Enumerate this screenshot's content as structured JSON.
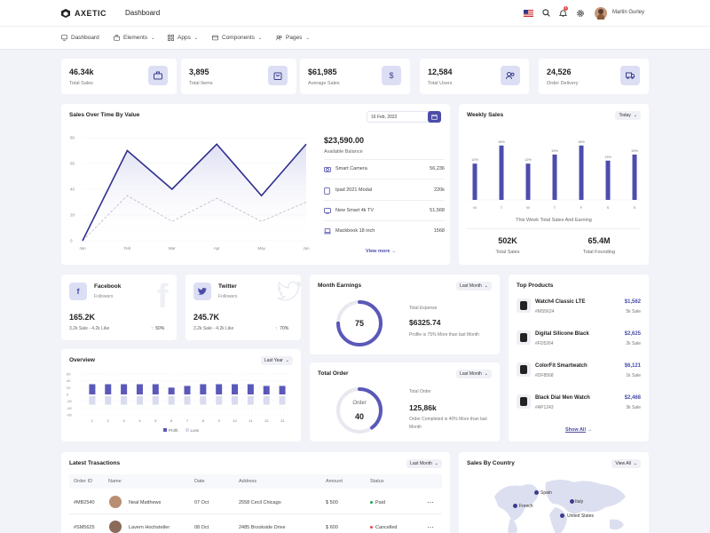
{
  "header": {
    "brand": "AXETIC",
    "page_title": "Dashboard",
    "user_name": "Martin Gurley",
    "notification_count": "4"
  },
  "nav": {
    "items": [
      {
        "label": "Dashboard",
        "icon": "monitor-icon"
      },
      {
        "label": "Elements",
        "icon": "briefcase-icon"
      },
      {
        "label": "Apps",
        "icon": "grid-icon"
      },
      {
        "label": "Components",
        "icon": "layers-icon"
      },
      {
        "label": "Pages",
        "icon": "users-icon"
      }
    ]
  },
  "stats": [
    {
      "value": "46.34k",
      "label": "Total Sales",
      "icon": "briefcase-icon"
    },
    {
      "value": "3,895",
      "label": "Total Items",
      "icon": "bag-icon"
    },
    {
      "value": "$61,985",
      "label": "Average Sales",
      "icon": "dollar-icon"
    },
    {
      "value": "12,584",
      "label": "Total Users",
      "icon": "users-icon"
    },
    {
      "value": "24,526",
      "label": "Order Delivery",
      "icon": "truck-icon"
    }
  ],
  "sales_over_time": {
    "title": "Sales Over Time By Value",
    "date": "16 Feb, 2022",
    "balance": "$23,590.00",
    "balance_label": "Available Balance",
    "items": [
      {
        "name": "Smart Camera",
        "value": "56,236",
        "icon": "camera-icon"
      },
      {
        "name": "Ipad 2021 Modal",
        "value": "220k",
        "icon": "tablet-icon"
      },
      {
        "name": "New Smart 4k TV",
        "value": "51,568",
        "icon": "tv-icon"
      },
      {
        "name": "Mackbook 18 inch",
        "value": "1568",
        "icon": "laptop-icon"
      }
    ],
    "view_more": "View more"
  },
  "weekly_sales": {
    "title": "Weekly Sales",
    "filter": "Today",
    "caption": "This Week Total Sales And Earning",
    "total_sales_value": "502K",
    "total_sales_label": "Total Sales",
    "total_founding_value": "65.4M",
    "total_founding_label": "Total Founding"
  },
  "facebook": {
    "title": "Facebook",
    "subtitle": "Followers",
    "value": "165.2K",
    "detail": "3.2k Sale - 4.2k Like",
    "percent": "50%"
  },
  "twitter": {
    "title": "Twitter",
    "subtitle": "Followers",
    "value": "245.7K",
    "detail": "3.2k Sale - 4.2k Like",
    "percent": "70%"
  },
  "month_earnings": {
    "title": "Month Earnings",
    "filter": "Last Month",
    "gauge_value": "75",
    "gauge_fraction": 0.75,
    "expense_label": "Total Expense",
    "expense_value": "$6325.74",
    "note": "Profile is 75% More than last Month"
  },
  "total_order": {
    "title": "Total Order",
    "filter": "Last Month",
    "gauge_label": "Order",
    "gauge_value": "40",
    "gauge_fraction": 0.4,
    "order_label": "Total Order",
    "order_value": "125,86k",
    "note": "Order Completed is 40% More than last Month"
  },
  "overview": {
    "title": "Overview",
    "filter": "Last Year",
    "legend_profit": "Profit",
    "legend_loss": "Loss"
  },
  "top_products": {
    "title": "Top Products",
    "items": [
      {
        "name": "Watch4 Classic LTE",
        "code": "#MS5624",
        "price": "$1,562",
        "stock": "5k Sale"
      },
      {
        "name": "Digital Silicone Black",
        "code": "#FD5264",
        "price": "$2,625",
        "stock": "2k Sale"
      },
      {
        "name": "ColorFit Smartwatch",
        "code": "#DF8568",
        "price": "$6,121",
        "stock": "1k Sale"
      },
      {
        "name": "Black Dial Men Watch",
        "code": "#AP1243",
        "price": "$2,468",
        "stock": "3k Sale"
      }
    ],
    "show_all": "Show All"
  },
  "transactions": {
    "title": "Latest Trasactions",
    "filter": "Last Month",
    "headers": [
      "Order ID",
      "Name",
      "Date",
      "Address",
      "Amount",
      "Status"
    ],
    "rows": [
      {
        "id": "#MB2540",
        "name": "Neal Matthews",
        "date": "07 Oct",
        "address": "2558 Cecil Chicago",
        "amount": "$ 500",
        "status": "Paid",
        "status_color": "#1aa85c"
      },
      {
        "id": "#SM5625",
        "name": "Lavern Hochstetler",
        "date": "08 Oct",
        "address": "2485 Brookside Drive",
        "amount": "$ 600",
        "status": "Cancelled",
        "status_color": "#e5484d"
      }
    ]
  },
  "sales_by_country": {
    "title": "Sales By Country",
    "filter": "View All",
    "countries": [
      "Spain",
      "Italy",
      "French",
      "United States"
    ]
  },
  "chart_data": [
    {
      "type": "line",
      "x": [
        "Jan",
        "Feb",
        "Mar",
        "Apr",
        "May",
        "Jun"
      ],
      "ylim": [
        0,
        80
      ],
      "yticks": [
        0,
        20,
        40,
        60,
        80
      ],
      "series": [
        {
          "values": [
            0,
            70,
            40,
            75,
            35,
            75
          ],
          "color": "#2f2f8f"
        },
        {
          "values": [
            0,
            35,
            15,
            33,
            15,
            30
          ],
          "color": "#b8b8c8"
        }
      ]
    },
    {
      "type": "bar",
      "categories": [
        "M",
        "T",
        "W",
        "T",
        "F",
        "S",
        "S"
      ],
      "values": [
        12,
        18,
        12,
        15,
        18,
        13,
        15
      ],
      "labels": [
        "12%",
        "18%",
        "12%",
        "15%",
        "18%",
        "13%",
        "15%"
      ],
      "ylim": [
        0,
        20
      ],
      "color": "#4d4cad"
    },
    {
      "type": "bar",
      "categories": [
        "1",
        "2",
        "3",
        "4",
        "5",
        "6",
        "7",
        "8",
        "9",
        "10",
        "11",
        "12",
        "13"
      ],
      "ylim": [
        -60,
        60
      ],
      "yticks": [
        60,
        40,
        20,
        0,
        -20,
        -40,
        -60
      ],
      "series": [
        {
          "name": "Profit",
          "values": [
            30,
            30,
            30,
            30,
            30,
            20,
            25,
            30,
            30,
            30,
            30,
            25,
            25
          ],
          "color": "#5a58b8"
        },
        {
          "name": "Loss",
          "values": [
            -30,
            -30,
            -30,
            -30,
            -30,
            -30,
            -30,
            -30,
            -30,
            -30,
            -30,
            -30,
            -30
          ],
          "color": "#d9dbef"
        }
      ]
    }
  ],
  "colors": {
    "accent": "#4b4ca8",
    "accent_light": "#dcdff4",
    "background": "#f2f3f8"
  }
}
